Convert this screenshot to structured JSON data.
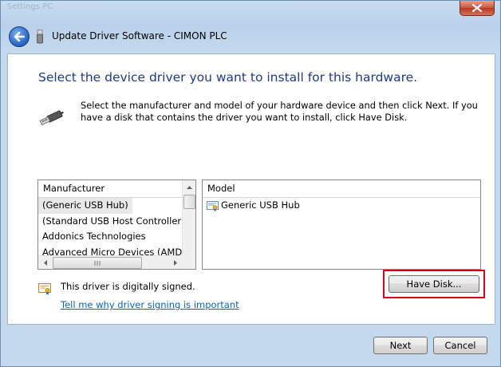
{
  "window": {
    "background_title": "Settings PC",
    "title": "Update Driver Software - CIMON PLC"
  },
  "main": {
    "heading": "Select the device driver you want to install for this hardware.",
    "description": "Select the manufacturer and model of your hardware device and then click Next. If you have a disk that contains the driver you want to install, click Have Disk."
  },
  "manufacturer_list": {
    "header": "Manufacturer",
    "items": [
      "(Generic USB Hub)",
      "(Standard USB Host Controller)",
      "Addonics Technologies",
      "Advanced Micro Devices (AMD)"
    ],
    "selected_index": 0
  },
  "model_list": {
    "header": "Model",
    "items": [
      "Generic USB Hub"
    ]
  },
  "signing": {
    "status": "This driver is digitally signed.",
    "link": "Tell me why driver signing is important"
  },
  "buttons": {
    "have_disk": "Have Disk...",
    "next": "Next",
    "cancel": "Cancel"
  },
  "colors": {
    "heading": "#1e3a8a",
    "link": "#0066cc",
    "highlight_box": "#e0001a"
  }
}
